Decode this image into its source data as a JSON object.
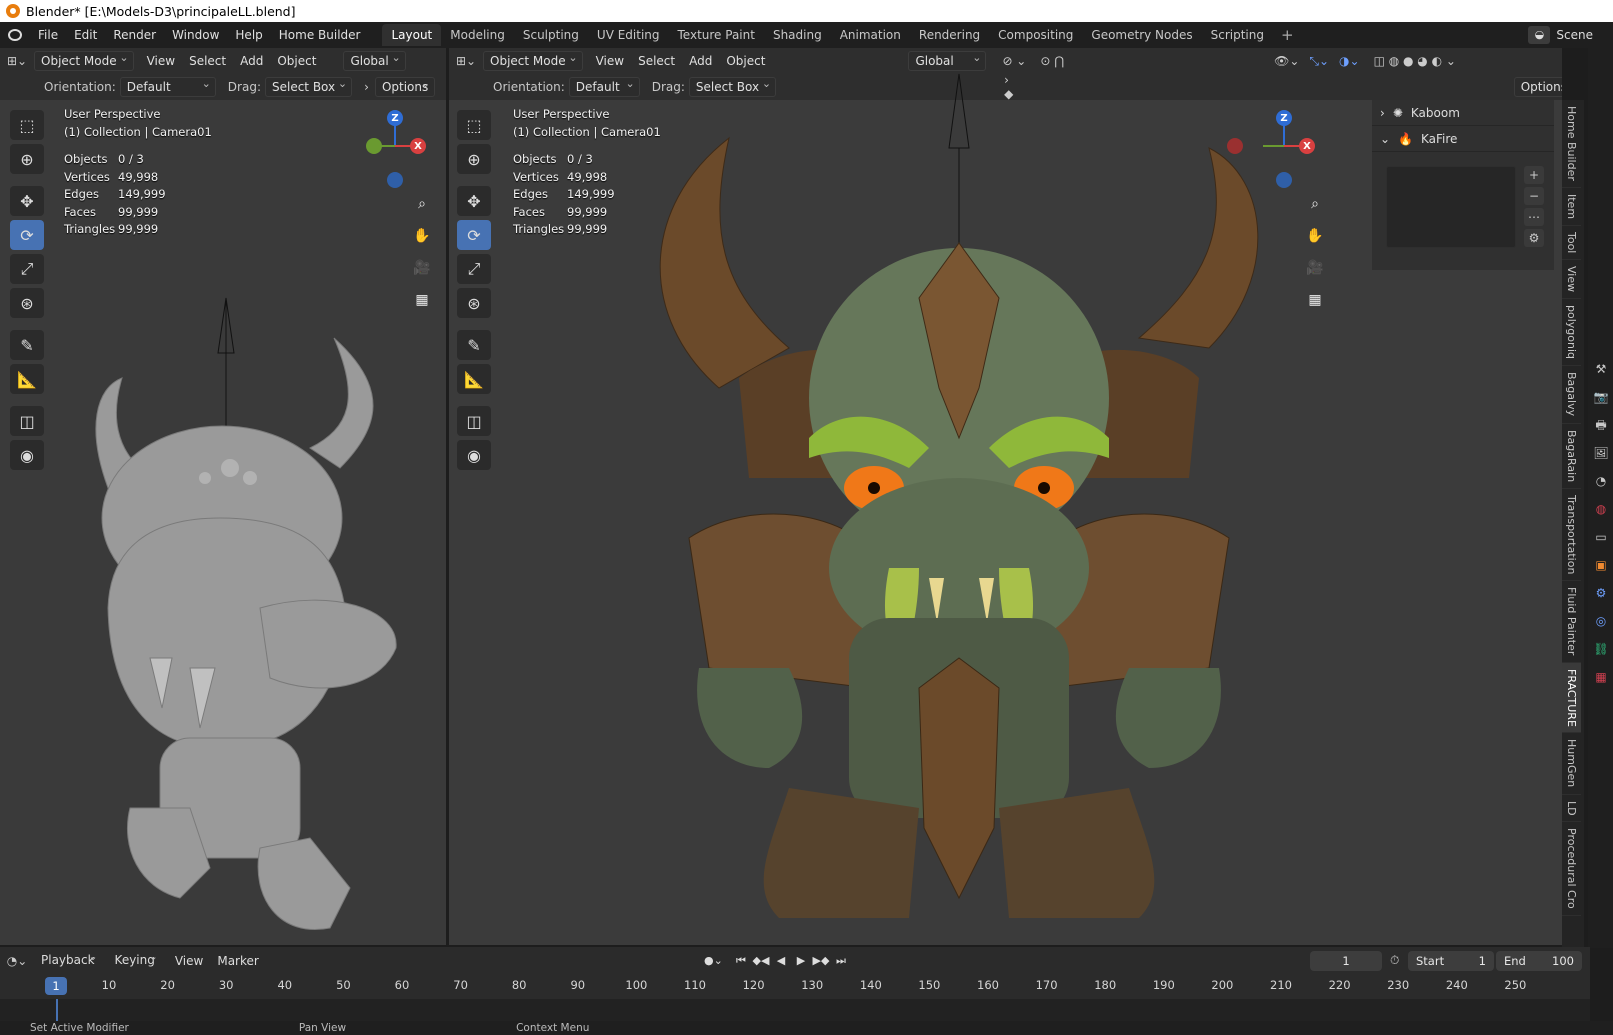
{
  "window": {
    "title": "Blender* [E:\\Models-D3\\principaleLL.blend]"
  },
  "menu": [
    "File",
    "Edit",
    "Render",
    "Window",
    "Help",
    "Home Builder"
  ],
  "workspaces": [
    "Layout",
    "Modeling",
    "Sculpting",
    "UV Editing",
    "Texture Paint",
    "Shading",
    "Animation",
    "Rendering",
    "Compositing",
    "Geometry Nodes",
    "Scripting"
  ],
  "active_workspace": "Layout",
  "scene": "Scene",
  "left_viewport": {
    "mode": "Object Mode",
    "menus": [
      "View",
      "Select",
      "Add",
      "Object"
    ],
    "transform": "Global",
    "orientation_label": "Orientation:",
    "orientation": "Default",
    "drag_label": "Drag:",
    "drag": "Select Box",
    "options": "Options",
    "perspective": "User Perspective",
    "collection": "(1) Collection | Camera01",
    "stats": [
      [
        "Objects",
        "0 / 3"
      ],
      [
        "Vertices",
        "49,998"
      ],
      [
        "Edges",
        "149,999"
      ],
      [
        "Faces",
        "99,999"
      ],
      [
        "Triangles",
        "99,999"
      ]
    ]
  },
  "right_viewport": {
    "mode": "Object Mode",
    "menus": [
      "View",
      "Select",
      "Add",
      "Object"
    ],
    "transform": "Global",
    "orientation_label": "Orientation:",
    "orientation": "Default",
    "drag_label": "Drag:",
    "drag": "Select Box",
    "options": "Options",
    "perspective": "User Perspective",
    "collection": "(1) Collection | Camera01",
    "stats": [
      [
        "Objects",
        "0 / 3"
      ],
      [
        "Vertices",
        "49,998"
      ],
      [
        "Edges",
        "149,999"
      ],
      [
        "Faces",
        "99,999"
      ],
      [
        "Triangles",
        "99,999"
      ]
    ]
  },
  "npanel": {
    "items": [
      "Kaboom",
      "KaFire"
    ]
  },
  "sidebar_tabs": [
    "Home Builder",
    "Item",
    "Tool",
    "View",
    "polygoniq",
    "Bagalvy",
    "BagaRain",
    "Transportation",
    "Fluid Painter",
    "FRACTURE",
    "HumGen",
    "LD",
    "Procedural Cro"
  ],
  "sidebar_active": "FRACTURE",
  "gizmo": {
    "z": "Z",
    "x": "X"
  },
  "timeline": {
    "menus": [
      "Playback",
      "Keying",
      "View",
      "Marker"
    ],
    "current_frame": "1",
    "start_label": "Start",
    "start": "1",
    "end_label": "End",
    "end": "100",
    "ticks": [
      "1",
      "10",
      "20",
      "30",
      "40",
      "50",
      "60",
      "70",
      "80",
      "90",
      "100",
      "110",
      "120",
      "130",
      "140",
      "150",
      "160",
      "170",
      "180",
      "190",
      "200",
      "210",
      "220",
      "230",
      "240",
      "250"
    ]
  },
  "status": [
    "Set Active Modifier",
    "Pan View",
    "Context Menu"
  ]
}
